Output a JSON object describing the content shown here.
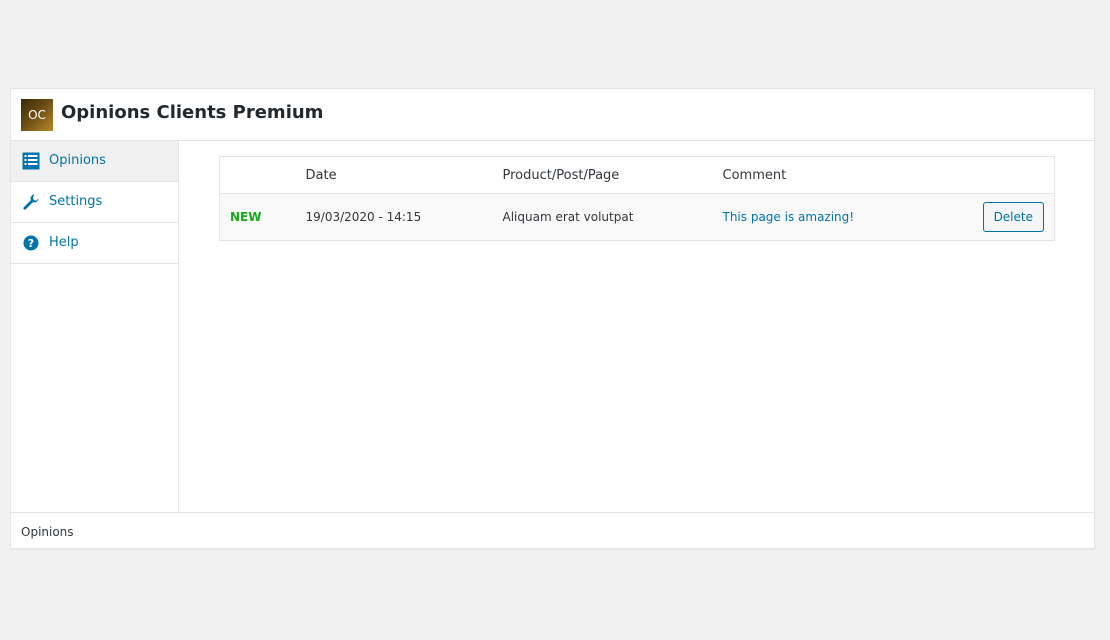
{
  "header": {
    "logo_text": "OC",
    "title": "Opinions Clients Premium"
  },
  "sidebar": {
    "items": [
      {
        "label": "Opinions",
        "icon": "list-icon",
        "active": true
      },
      {
        "label": "Settings",
        "icon": "wrench-icon",
        "active": false
      },
      {
        "label": "Help",
        "icon": "help-icon",
        "active": false
      }
    ]
  },
  "table": {
    "columns": [
      "",
      "Date",
      "Product/Post/Page",
      "Comment",
      ""
    ],
    "rows": [
      {
        "status": "NEW",
        "date": "19/03/2020 - 14:15",
        "product": "Aliquam erat volutpat",
        "comment": "This page is amazing!",
        "action": "Delete"
      }
    ]
  },
  "footer": {
    "label": "Opinions"
  },
  "colors": {
    "accent": "#0073aa",
    "new_status": "#16a91b",
    "background": "#f1f1f1"
  }
}
